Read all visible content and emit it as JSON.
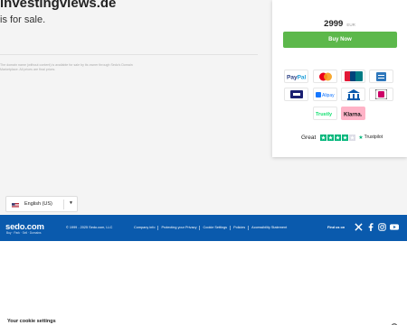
{
  "listing": {
    "domain": "investingviews.de",
    "for_sale": "is for sale.",
    "fine_print": "The domain name (without content) is available for sale by its owner through Sedo's Domain Marketplace. All prices are final prices."
  },
  "offer": {
    "price": "2999",
    "currency": "EUR",
    "buy_label": "Buy Now",
    "payment_methods": [
      "PayPal",
      "Mastercard",
      "UnionPay",
      "American Express",
      "Visa",
      "Alipay",
      "Bank transfer",
      "iDEAL",
      "Trustly",
      "Klarna"
    ]
  },
  "trustpilot": {
    "rating_text": "Great",
    "brand": "Trustpilot",
    "stars": 4
  },
  "language": {
    "selected": "English (US)"
  },
  "footer": {
    "logo": "sedo.com",
    "tagline": "Buy · Park · Sell · Domains",
    "copyright": "© 1999 - 2025 Sedo.com, LLC",
    "links": [
      "Company info",
      "Protecting your Privacy",
      "Cookie Settings",
      "Policies",
      "Accessibility Statement"
    ],
    "find_us": "Find us on",
    "social": [
      "x-icon",
      "facebook-icon",
      "instagram-icon",
      "youtube-icon"
    ]
  },
  "cookie": {
    "title": "Your cookie settings"
  },
  "colors": {
    "buy_button": "#5cb84b",
    "footer_bg": "#0a5aad",
    "trustpilot_green": "#00b67a"
  }
}
